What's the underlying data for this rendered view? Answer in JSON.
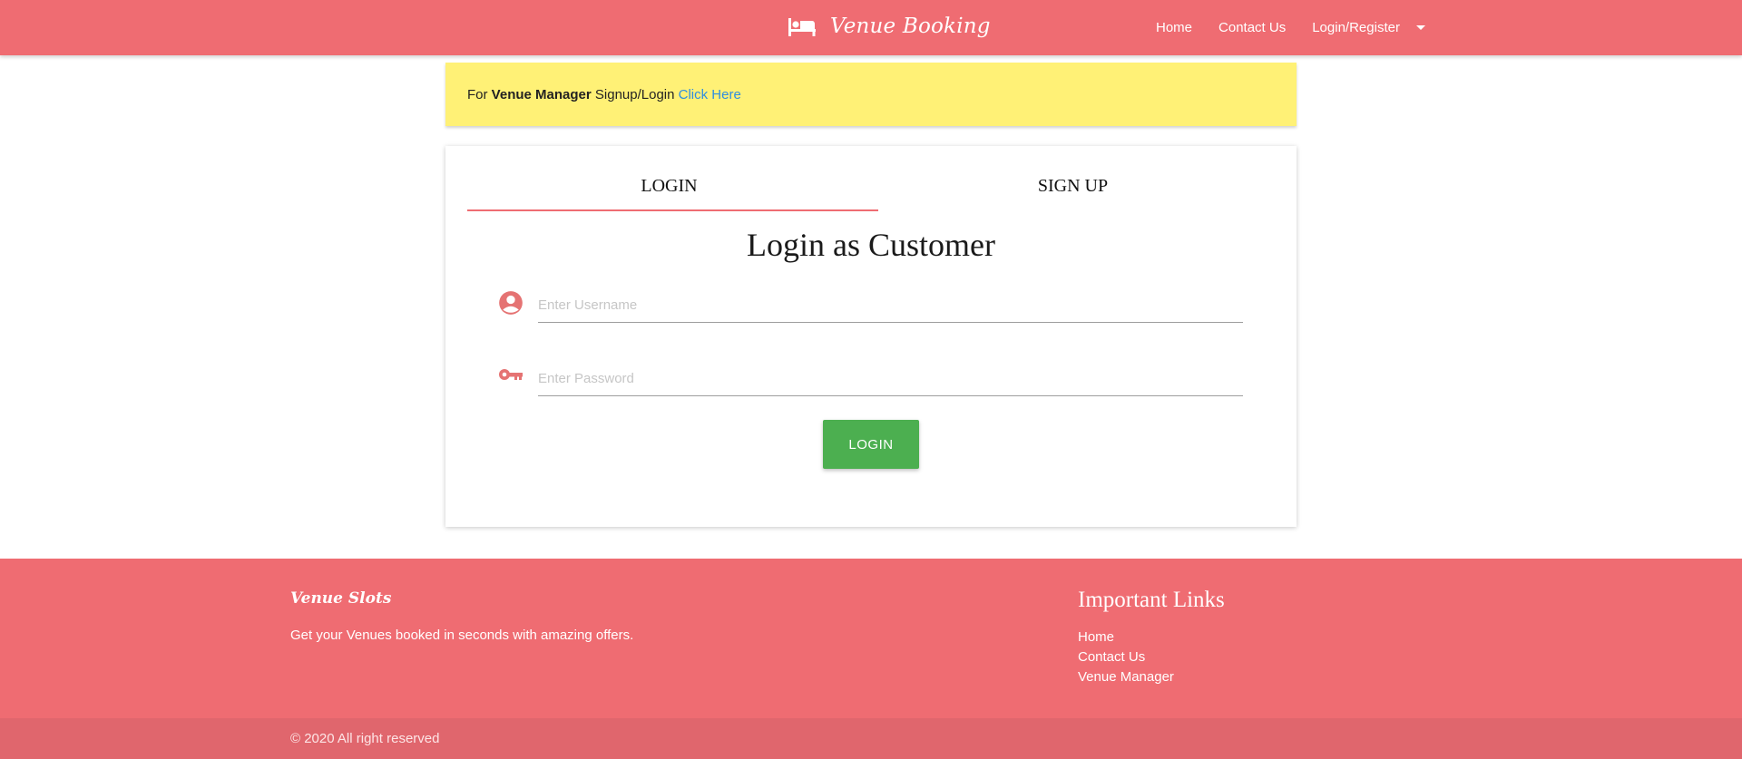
{
  "navbar": {
    "brand": "Venue Booking",
    "brand_icon": "bed-icon",
    "links": [
      "Home",
      "Contact Us",
      "Login/Register"
    ]
  },
  "notice": {
    "prefix": "For ",
    "bold": "Venue Manager",
    "middle": " Signup/Login ",
    "link": "Click Here"
  },
  "card": {
    "tabs": [
      "LOGIN",
      "SIGN UP"
    ],
    "active_tab": "LOGIN",
    "title": "Login as Customer",
    "username_placeholder": "Enter Username",
    "password_placeholder": "Enter Password",
    "login_button": "LOGIN"
  },
  "footer": {
    "brand": "Venue Slots",
    "description": "Get your Venues booked in seconds with amazing offers.",
    "links_title": "Important Links",
    "links": [
      "Home",
      "Contact Us",
      "Venue Manager"
    ],
    "copyright": "© 2020 All right reserved"
  },
  "colors": {
    "primary": "#ef6c72",
    "notice_bg": "#fff176",
    "button_green": "#4caf50",
    "link_blue": "#2f8ee0"
  }
}
